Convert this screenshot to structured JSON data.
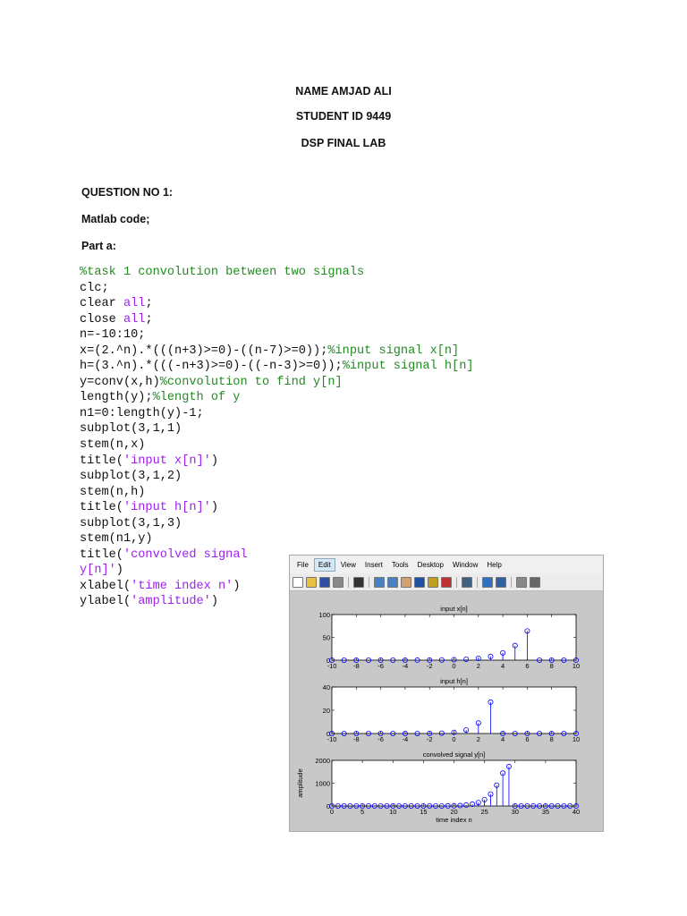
{
  "header": {
    "name": "NAME AMJAD ALI",
    "student_id": "STUDENT ID 9449",
    "lab": "DSP FINAL LAB"
  },
  "question": "QUESTION NO 1:",
  "code_label": "Matlab code;",
  "part": "Part a:",
  "code_lines": [
    [
      [
        "%task 1 convolution between two signals",
        "cm"
      ]
    ],
    [
      [
        "clc;",
        ""
      ]
    ],
    [
      [
        "clear ",
        ""
      ],
      [
        "all",
        "kw"
      ],
      [
        ";",
        ""
      ]
    ],
    [
      [
        "close ",
        ""
      ],
      [
        "all",
        "kw"
      ],
      [
        ";",
        ""
      ]
    ],
    [
      [
        "n=-10:10;",
        ""
      ]
    ],
    [
      [
        "x=(2.^n).*(((n+3)>=0)-((n-7)>=0));",
        ""
      ],
      [
        "%input signal x[n]",
        "cm"
      ]
    ],
    [
      [
        "h=(3.^n).*(((-n+3)>=0)-((-n-3)>=0));",
        ""
      ],
      [
        "%input signal h[n]",
        "cm"
      ]
    ],
    [
      [
        "y=conv(x,h)",
        ""
      ],
      [
        "%convolution to find y[n]",
        "cm"
      ]
    ],
    [
      [
        "length(y);",
        ""
      ],
      [
        "%length of y",
        "cm"
      ]
    ],
    [
      [
        "n1=0:length(y)-1;",
        ""
      ]
    ],
    [
      [
        "subplot(3,1,1)",
        ""
      ]
    ],
    [
      [
        "stem(n,x)",
        ""
      ]
    ],
    [
      [
        "title(",
        ""
      ],
      [
        "'input x[n]'",
        "st"
      ],
      [
        ")",
        ""
      ]
    ],
    [
      [
        "subplot(3,1,2)",
        ""
      ]
    ],
    [
      [
        "stem(n,h)",
        ""
      ]
    ],
    [
      [
        "title(",
        ""
      ],
      [
        "'input h[n]'",
        "st"
      ],
      [
        ")",
        ""
      ]
    ],
    [
      [
        "subplot(3,1,3)",
        ""
      ]
    ],
    [
      [
        "stem(n1,y)",
        ""
      ]
    ],
    [
      [
        "title(",
        ""
      ],
      [
        "'convolved signal",
        "st"
      ]
    ],
    [
      [
        "y[n]'",
        "st"
      ],
      [
        ")",
        ""
      ]
    ],
    [
      [
        "xlabel(",
        ""
      ],
      [
        "'time index n'",
        "st"
      ],
      [
        ")",
        ""
      ]
    ],
    [
      [
        "ylabel(",
        ""
      ],
      [
        "'amplitude'",
        "st"
      ],
      [
        ")",
        ""
      ]
    ]
  ],
  "figure": {
    "menu": [
      "File",
      "Edit",
      "View",
      "Insert",
      "Tools",
      "Desktop",
      "Window",
      "Help"
    ],
    "active_menu": "Edit",
    "toolbar_icons": [
      "new-file-icon",
      "open-folder-icon",
      "save-icon",
      "print-icon",
      "|",
      "pointer-icon",
      "|",
      "zoom-in-icon",
      "zoom-out-icon",
      "pan-hand-icon",
      "rotate-3d-icon",
      "data-cursor-icon",
      "brush-icon",
      "|",
      "link-plot-icon",
      "|",
      "colorbar-icon",
      "legend-icon",
      "|",
      "hide-plot-tools-icon",
      "show-plot-tools-icon"
    ],
    "stem_color": "#0000ff"
  },
  "chart_data": [
    {
      "type": "stem",
      "title": "input x[n]",
      "xlabel": "",
      "ylabel": "",
      "xlim": [
        -10,
        10
      ],
      "ylim": [
        0,
        100
      ],
      "xticks": [
        "-10",
        "-8",
        "-6",
        "-4",
        "-2",
        "0",
        "2",
        "4",
        "6",
        "8",
        "10"
      ],
      "yticks": [
        "0",
        "50",
        "100"
      ],
      "x": [
        -10,
        -9,
        -8,
        -7,
        -6,
        -5,
        -4,
        -3,
        -2,
        -1,
        0,
        1,
        2,
        3,
        4,
        5,
        6,
        7,
        8,
        9,
        10
      ],
      "values": [
        0,
        0,
        0,
        0,
        0,
        0,
        0,
        0.125,
        0.25,
        0.5,
        1,
        2,
        4,
        8,
        16,
        32,
        64,
        0,
        0,
        0,
        0
      ]
    },
    {
      "type": "stem",
      "title": "input h[n]",
      "xlabel": "",
      "ylabel": "",
      "xlim": [
        -10,
        10
      ],
      "ylim": [
        0,
        40
      ],
      "xticks": [
        "-10",
        "-8",
        "-6",
        "-4",
        "-2",
        "0",
        "2",
        "4",
        "6",
        "8",
        "10"
      ],
      "yticks": [
        "0",
        "20",
        "40"
      ],
      "x": [
        -10,
        -9,
        -8,
        -7,
        -6,
        -5,
        -4,
        -3,
        -2,
        -1,
        0,
        1,
        2,
        3,
        4,
        5,
        6,
        7,
        8,
        9,
        10
      ],
      "values": [
        0,
        0,
        0,
        0,
        0,
        0,
        0,
        0.037,
        0.111,
        0.333,
        1,
        3,
        9,
        27,
        0,
        0,
        0,
        0,
        0,
        0,
        0
      ]
    },
    {
      "type": "stem",
      "title": "convolved signal y[n]",
      "xlabel": "time index n",
      "ylabel": "amplitude",
      "xlim": [
        0,
        40
      ],
      "ylim": [
        0,
        2000
      ],
      "xticks": [
        "0",
        "5",
        "10",
        "15",
        "20",
        "25",
        "30",
        "35",
        "40"
      ],
      "yticks": [
        "0",
        "1000",
        "2000"
      ],
      "x": [
        0,
        1,
        2,
        3,
        4,
        5,
        6,
        7,
        8,
        9,
        10,
        11,
        12,
        13,
        14,
        15,
        16,
        17,
        18,
        19,
        20,
        21,
        22,
        23,
        24,
        25,
        26,
        27,
        28,
        29,
        30,
        31,
        32,
        33,
        34,
        35,
        36,
        37,
        38,
        39,
        40
      ],
      "values": [
        0,
        0,
        0,
        0,
        0,
        0,
        0,
        0,
        0,
        0,
        0,
        0,
        0,
        0,
        0.005,
        0.023,
        0.088,
        0.301,
        0.977,
        3.08,
        9.53,
        19.07,
        38.13,
        76.26,
        147.78,
        281.33,
        520,
        912,
        1440,
        1728,
        0,
        0,
        0,
        0,
        0,
        0,
        0,
        0,
        0,
        0,
        0
      ]
    }
  ]
}
